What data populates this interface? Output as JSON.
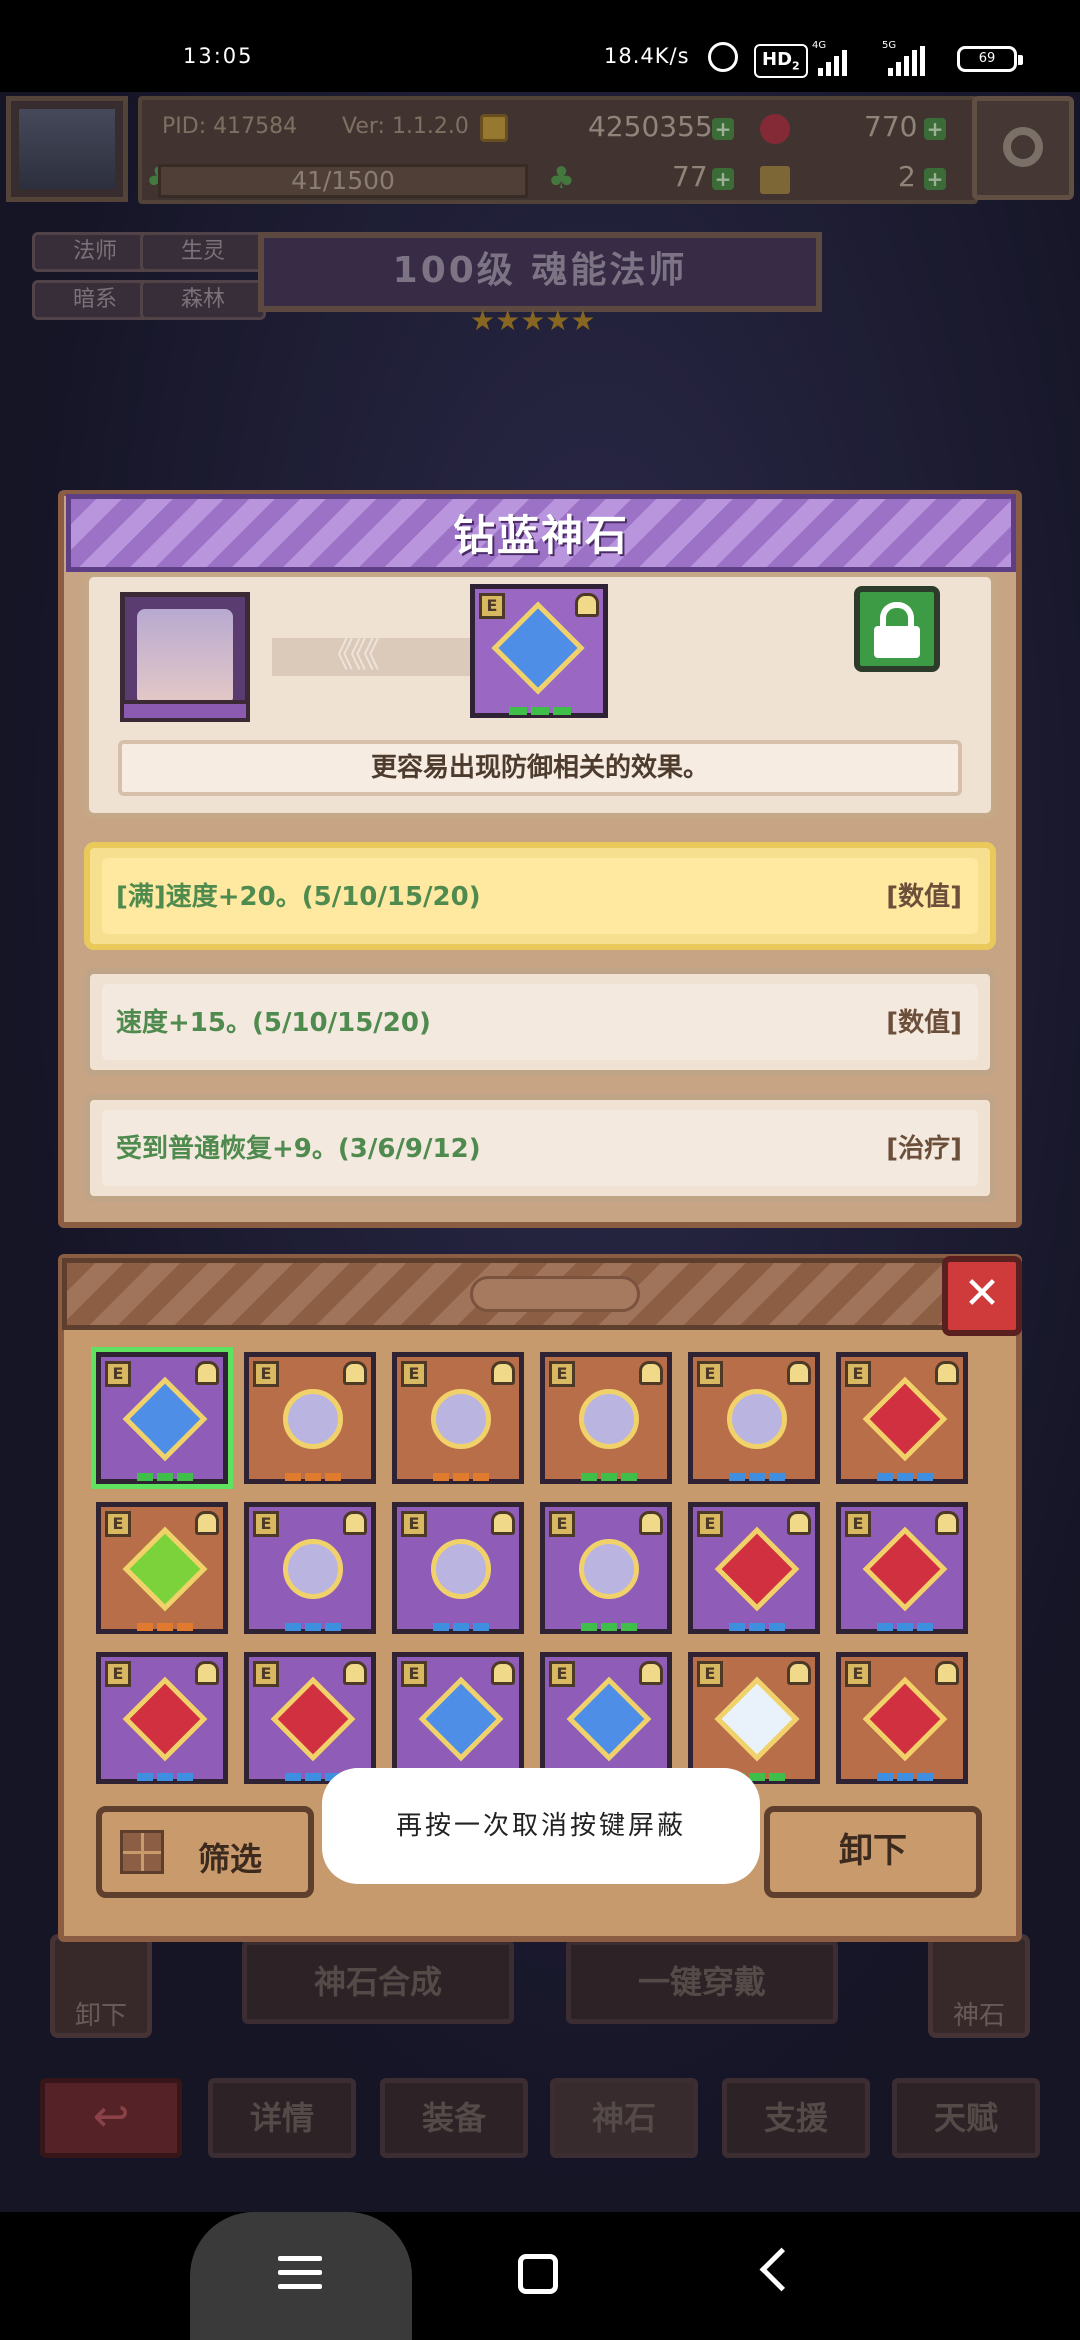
{
  "status_bar": {
    "time": "13:05",
    "network_speed": "18.4K/s",
    "hd_label": "HD",
    "hd_sub": "2",
    "sim1_gen": "4G",
    "sim2_gen": "5G",
    "battery": "69"
  },
  "hud": {
    "pid": "PID: 417584",
    "version": "Ver: 1.1.2.0",
    "gold": "4250355",
    "red_gems": "770",
    "xp": "41/1500",
    "clover_count": "77",
    "keys": "2"
  },
  "hero": {
    "tags": [
      "法师",
      "生灵",
      "暗系",
      "森林"
    ],
    "title": "100级 魂能法师",
    "stars": "★★★★★"
  },
  "gem_detail": {
    "title": "钻蓝神石",
    "description": "更容易出现防御相关的效果。",
    "arrows": "《《《",
    "effects": [
      {
        "text": "[满]速度+20。(5/10/15/20)",
        "category": "[数值]",
        "highlight": true
      },
      {
        "text": "速度+15。(5/10/15/20)",
        "category": "[数值]",
        "highlight": false
      },
      {
        "text": "受到普通恢复+9。(3/6/9/12)",
        "category": "[治疗]",
        "highlight": false
      }
    ]
  },
  "inventory": {
    "close_label": "✕",
    "equip_badge": "E",
    "gems": [
      {
        "bg": "purple",
        "gem": "blue",
        "pip_color": "#3fbf4a",
        "selected": true
      },
      {
        "bg": "orange",
        "gem": "silver",
        "pip_color": "#e07a2e",
        "selected": false
      },
      {
        "bg": "orange",
        "gem": "silver",
        "pip_color": "#e07a2e",
        "selected": false
      },
      {
        "bg": "orange",
        "gem": "silver",
        "pip_color": "#3fbf4a",
        "selected": false
      },
      {
        "bg": "orange",
        "gem": "silver",
        "pip_color": "#3f8fe0",
        "selected": false
      },
      {
        "bg": "orange",
        "gem": "red",
        "pip_color": "#3f8fe0",
        "selected": false
      },
      {
        "bg": "orange",
        "gem": "green",
        "pip_color": "#e07a2e",
        "selected": false
      },
      {
        "bg": "purple",
        "gem": "silver",
        "pip_color": "#3f8fe0",
        "selected": false
      },
      {
        "bg": "purple",
        "gem": "silver",
        "pip_color": "#3f8fe0",
        "selected": false
      },
      {
        "bg": "purple",
        "gem": "silver",
        "pip_color": "#3fbf4a",
        "selected": false
      },
      {
        "bg": "purple",
        "gem": "red",
        "pip_color": "#3f8fe0",
        "selected": false
      },
      {
        "bg": "purple",
        "gem": "red",
        "pip_color": "#3f8fe0",
        "selected": false
      },
      {
        "bg": "purple",
        "gem": "red",
        "pip_color": "#3f8fe0",
        "selected": false
      },
      {
        "bg": "purple",
        "gem": "red",
        "pip_color": "#3f8fe0",
        "selected": false
      },
      {
        "bg": "purple",
        "gem": "blue",
        "pip_color": "#3f8fe0",
        "selected": false
      },
      {
        "bg": "purple",
        "gem": "blue",
        "pip_color": "#3f8fe0",
        "selected": false
      },
      {
        "bg": "orange",
        "gem": "white",
        "pip_color": "#3fbf4a",
        "selected": false
      },
      {
        "bg": "orange",
        "gem": "red",
        "pip_color": "#3f8fe0",
        "selected": false
      }
    ],
    "filter_label": "筛选",
    "unequip_label": "卸下"
  },
  "toast": "再按一次取消按键屏蔽",
  "bottom_controls": {
    "left_side_label": "卸下",
    "synth_label": "神石合成",
    "one_click_label": "一键穿戴",
    "right_side_label": "神石",
    "back_icon": "↩",
    "tabs": [
      "详情",
      "装备",
      "神石",
      "支援",
      "天赋"
    ]
  },
  "colors": {
    "modal_title": "#9b72c6",
    "effect_text": "#4f8a4e",
    "highlight_row": "#f7df90",
    "close_button": "#cf3a3a",
    "lock_button": "#3d9b46",
    "selected_outline": "#5fe25f"
  }
}
